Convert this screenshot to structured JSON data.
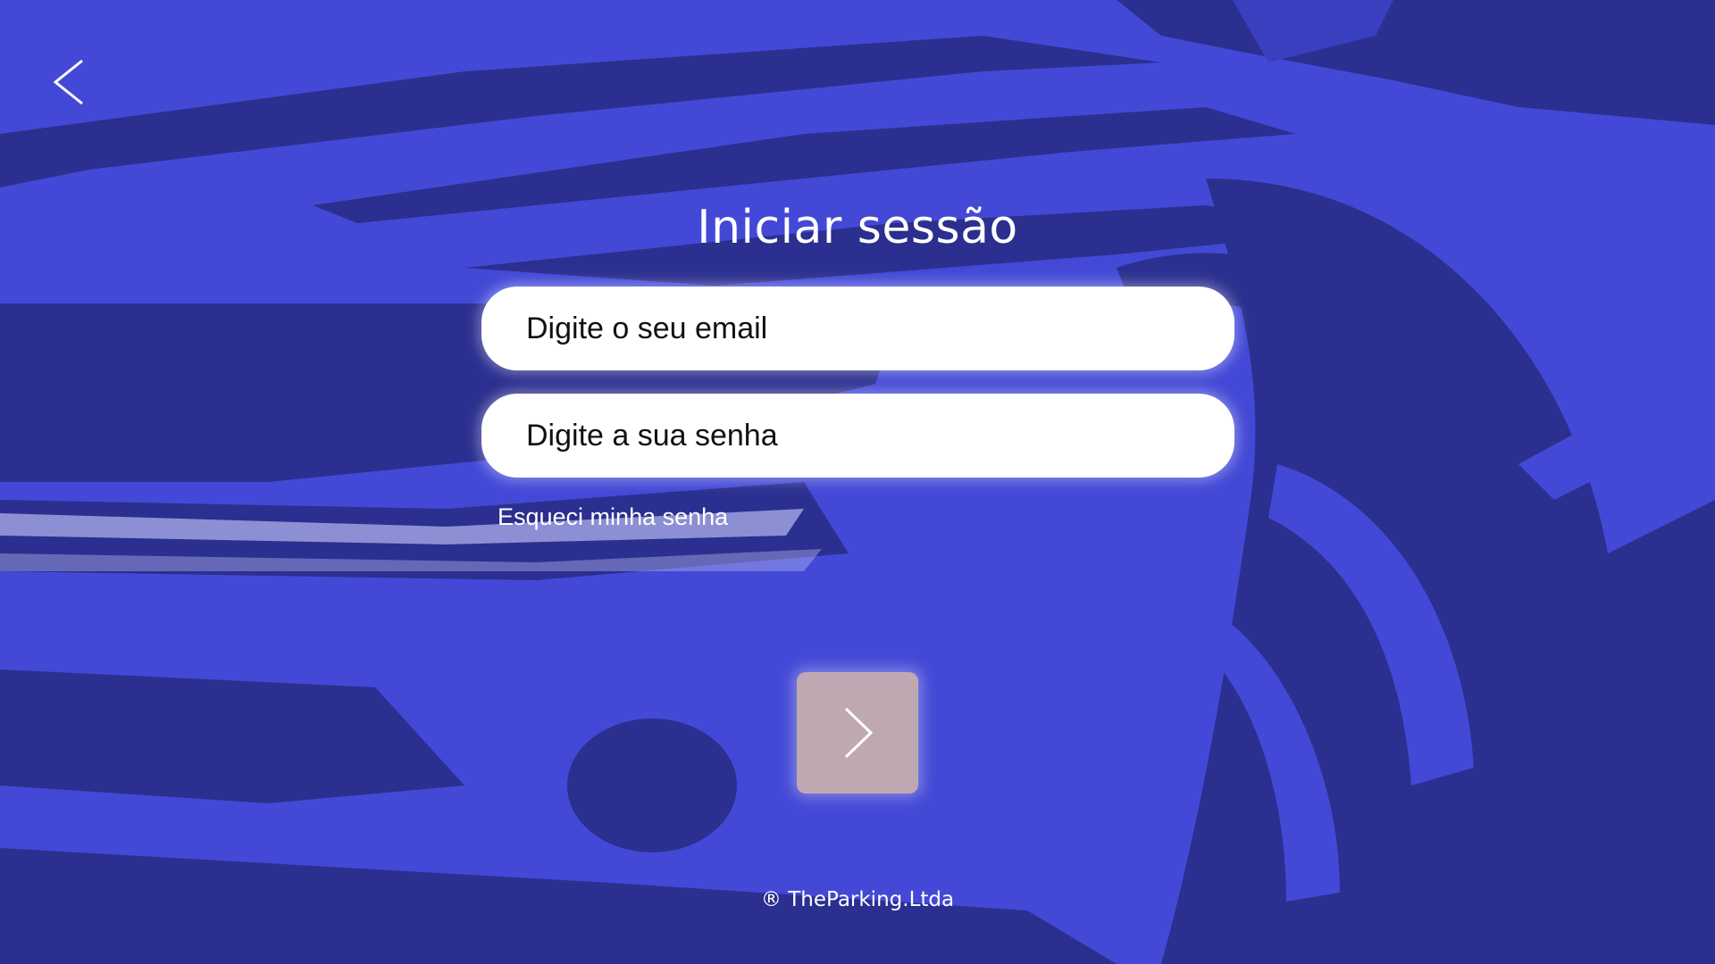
{
  "login": {
    "title": "Iniciar sessão",
    "email_placeholder": "Digite o seu email",
    "password_placeholder": "Digite a sua senha",
    "forgot_password": "Esqueci minha senha"
  },
  "footer": {
    "copyright": "® TheParking.Ltda"
  },
  "icons": {
    "back": "chevron-left-icon",
    "submit": "chevron-right-icon"
  },
  "colors": {
    "background": "#4349d6",
    "dark_shape": "#2b2f8f",
    "submit_button": "#bfa8b1",
    "text": "#ffffff"
  }
}
